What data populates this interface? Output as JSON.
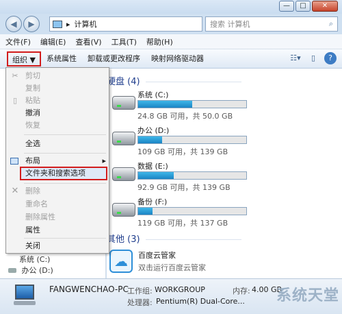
{
  "window": {
    "min_label": "—",
    "max_label": "□",
    "close_label": "✕"
  },
  "nav": {
    "back": "◀",
    "forward": "▶",
    "address_text": "计算机",
    "address_sep": "▸",
    "search_placeholder": "搜索 计算机"
  },
  "menubar": [
    "文件(F)",
    "编辑(E)",
    "查看(V)",
    "工具(T)",
    "帮助(H)"
  ],
  "toolbar": {
    "organize": "组织 ▼",
    "items": [
      "系统属性",
      "卸载或更改程序",
      "映射网络驱动器"
    ]
  },
  "sections": {
    "hard_disks": "硬盘 (4)",
    "other": "其他 (3)"
  },
  "drives": [
    {
      "name": "系统 (C:)",
      "size": "24.8 GB 可用，共 50.0 GB",
      "used_fraction": 0.5
    },
    {
      "name": "办公 (D:)",
      "size": "109 GB 可用，共 139 GB",
      "used_fraction": 0.22
    },
    {
      "name": "数据 (E:)",
      "size": "92.9 GB 可用，共 139 GB",
      "used_fraction": 0.33
    },
    {
      "name": "备份 (F:)",
      "size": "119 GB 可用，共 137 GB",
      "used_fraction": 0.13
    }
  ],
  "other_item": {
    "name": "百度云管家",
    "desc": "双击运行百度云管家"
  },
  "sidebar_visible": [
    "系统 (C:)",
    "办公 (D:)"
  ],
  "status": {
    "computer": "FANGWENCHAO-PC",
    "wg_label": "工作组:",
    "wg_value": "WORKGROUP",
    "cpu_label": "处理器:",
    "cpu_value": "Pentium(R) Dual-Core...",
    "mem_label": "内存:",
    "mem_value": "4.00 GB"
  },
  "org_menu": {
    "cut": "剪切",
    "copy": "复制",
    "paste": "粘贴",
    "undo": "撤消",
    "redo": "恢复",
    "select_all": "全选",
    "layout": "布局",
    "folder_options": "文件夹和搜索选项",
    "delete": "删除",
    "rename": "重命名",
    "remove_props": "删除属性",
    "properties": "属性",
    "close": "关闭"
  },
  "watermark": "系统天堂"
}
